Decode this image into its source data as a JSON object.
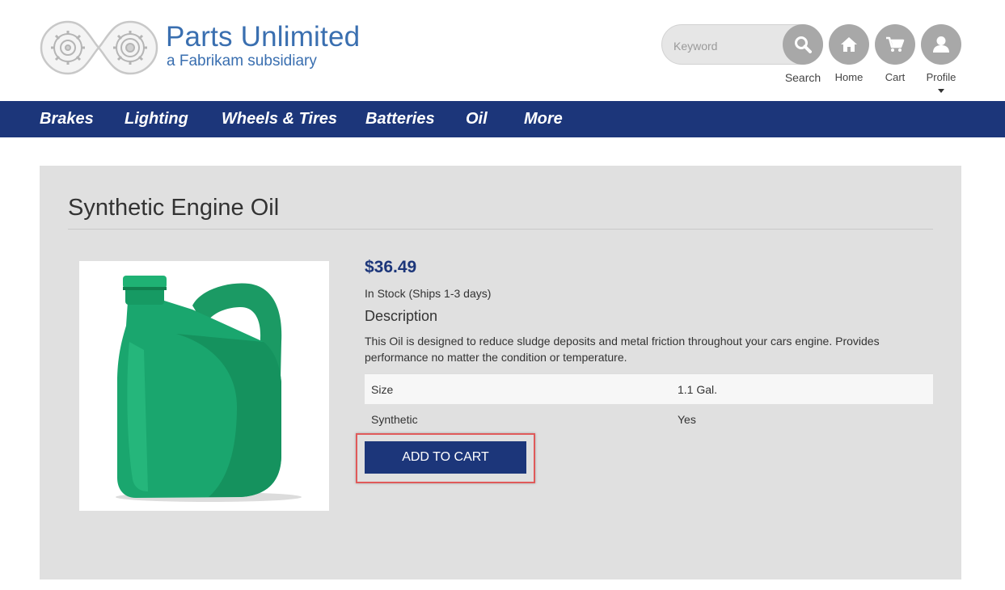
{
  "brand": {
    "title": "Parts Unlimited",
    "subtitle": "a Fabrikam subsidiary"
  },
  "header": {
    "search_placeholder": "Keyword",
    "search_label": "Search",
    "home_label": "Home",
    "cart_label": "Cart",
    "profile_label": "Profile"
  },
  "nav": {
    "items": [
      {
        "label": "Brakes"
      },
      {
        "label": "Lighting"
      },
      {
        "label": "Wheels & Tires"
      },
      {
        "label": "Batteries"
      },
      {
        "label": "Oil"
      },
      {
        "label": "More"
      }
    ]
  },
  "product": {
    "title": "Synthetic Engine Oil",
    "price": "$36.49",
    "stock": "In Stock (Ships 1-3 days)",
    "description_heading": "Description",
    "description": "This Oil is designed to reduce sludge deposits and metal friction throughout your cars engine. Provides performance no matter the condition or temperature.",
    "specs": [
      {
        "name": "Size",
        "value": "1.1 Gal."
      },
      {
        "name": "Synthetic",
        "value": "Yes"
      }
    ],
    "add_to_cart": "ADD TO CART"
  },
  "colors": {
    "nav_bg": "#1c367a",
    "brand_blue": "#3a6fb0",
    "panel_bg": "#e0e0e0",
    "icon_circle": "#a8a8a8",
    "highlight": "#e05a5a",
    "product_green": "#1aa66e"
  },
  "icons": {
    "search": "search-icon",
    "home": "home-icon",
    "cart": "cart-icon",
    "profile": "profile-icon",
    "profile_caret": "caret-down-icon"
  }
}
